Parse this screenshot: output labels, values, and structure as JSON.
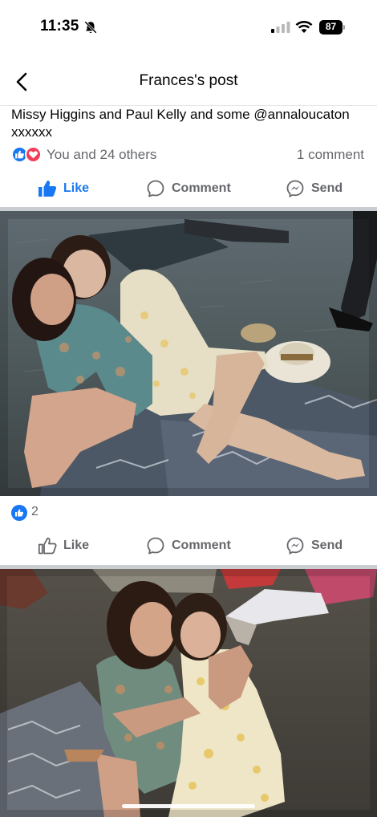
{
  "status_bar": {
    "time": "11:35",
    "battery": "87"
  },
  "header": {
    "title": "Frances's post"
  },
  "post": {
    "caption": "Missy Higgins and Paul Kelly and some @annaloucaton xxxxxx",
    "reactions_text": "You and 24 others",
    "comments_text": "1 comment"
  },
  "actions_main": {
    "like": "Like",
    "comment": "Comment",
    "send": "Send"
  },
  "photo1": {
    "like_count": "2"
  },
  "actions_photo1": {
    "like": "Like",
    "comment": "Comment",
    "send": "Send"
  },
  "colors": {
    "brand_blue": "#1877f2",
    "love_red": "#f33e58",
    "muted_text": "#65676b"
  },
  "icons": [
    "bell-slash-icon",
    "signal-icon",
    "wifi-icon",
    "battery-icon",
    "back-arrow-icon",
    "like-reaction-icon",
    "love-reaction-icon",
    "thumbs-up-icon",
    "comment-bubble-icon",
    "messenger-send-icon"
  ]
}
